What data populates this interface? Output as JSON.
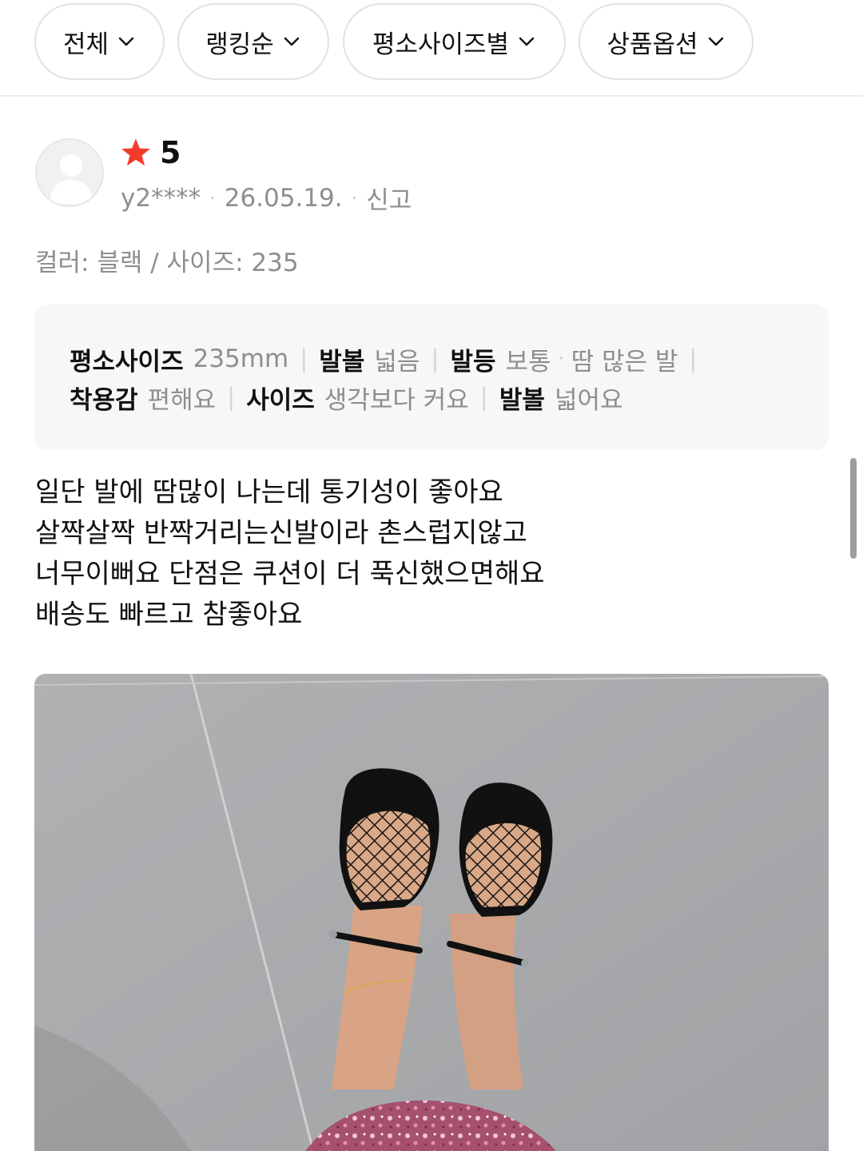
{
  "filters": [
    {
      "label": "전체"
    },
    {
      "label": "랭킹순"
    },
    {
      "label": "평소사이즈별"
    },
    {
      "label": "상품옵션"
    }
  ],
  "review": {
    "rating": "5",
    "user": "y2****",
    "date": "26.05.19.",
    "report_label": "신고",
    "option": "컬러: 블랙 / 사이즈: 235",
    "size_info": {
      "normal_size_label": "평소사이즈",
      "normal_size_value": "235mm",
      "foot_width_label": "발볼",
      "foot_width_value": "넓음",
      "instep_label": "발등",
      "instep_value": "보통",
      "sweat_value": "땀 많은 발",
      "comfort_label": "착용감",
      "comfort_value": "편해요",
      "fit_label": "사이즈",
      "fit_value": "생각보다 커요",
      "width_label": "발볼",
      "width_value": "넓어요"
    },
    "content_lines": [
      "일단 발에 땀많이 나는데 통기성이 좋아요",
      "살짝살짝 반짝거리는신발이라 촌스럽지않고",
      "너무이뻐요 단점은 쿠션이 더 푹신했으면해요",
      "배송도 빠르고 참좋아요"
    ]
  },
  "colors": {
    "star": "#f23b2b",
    "secondary_text": "#8e8e8e",
    "size_box_bg": "#f6f7f9"
  }
}
